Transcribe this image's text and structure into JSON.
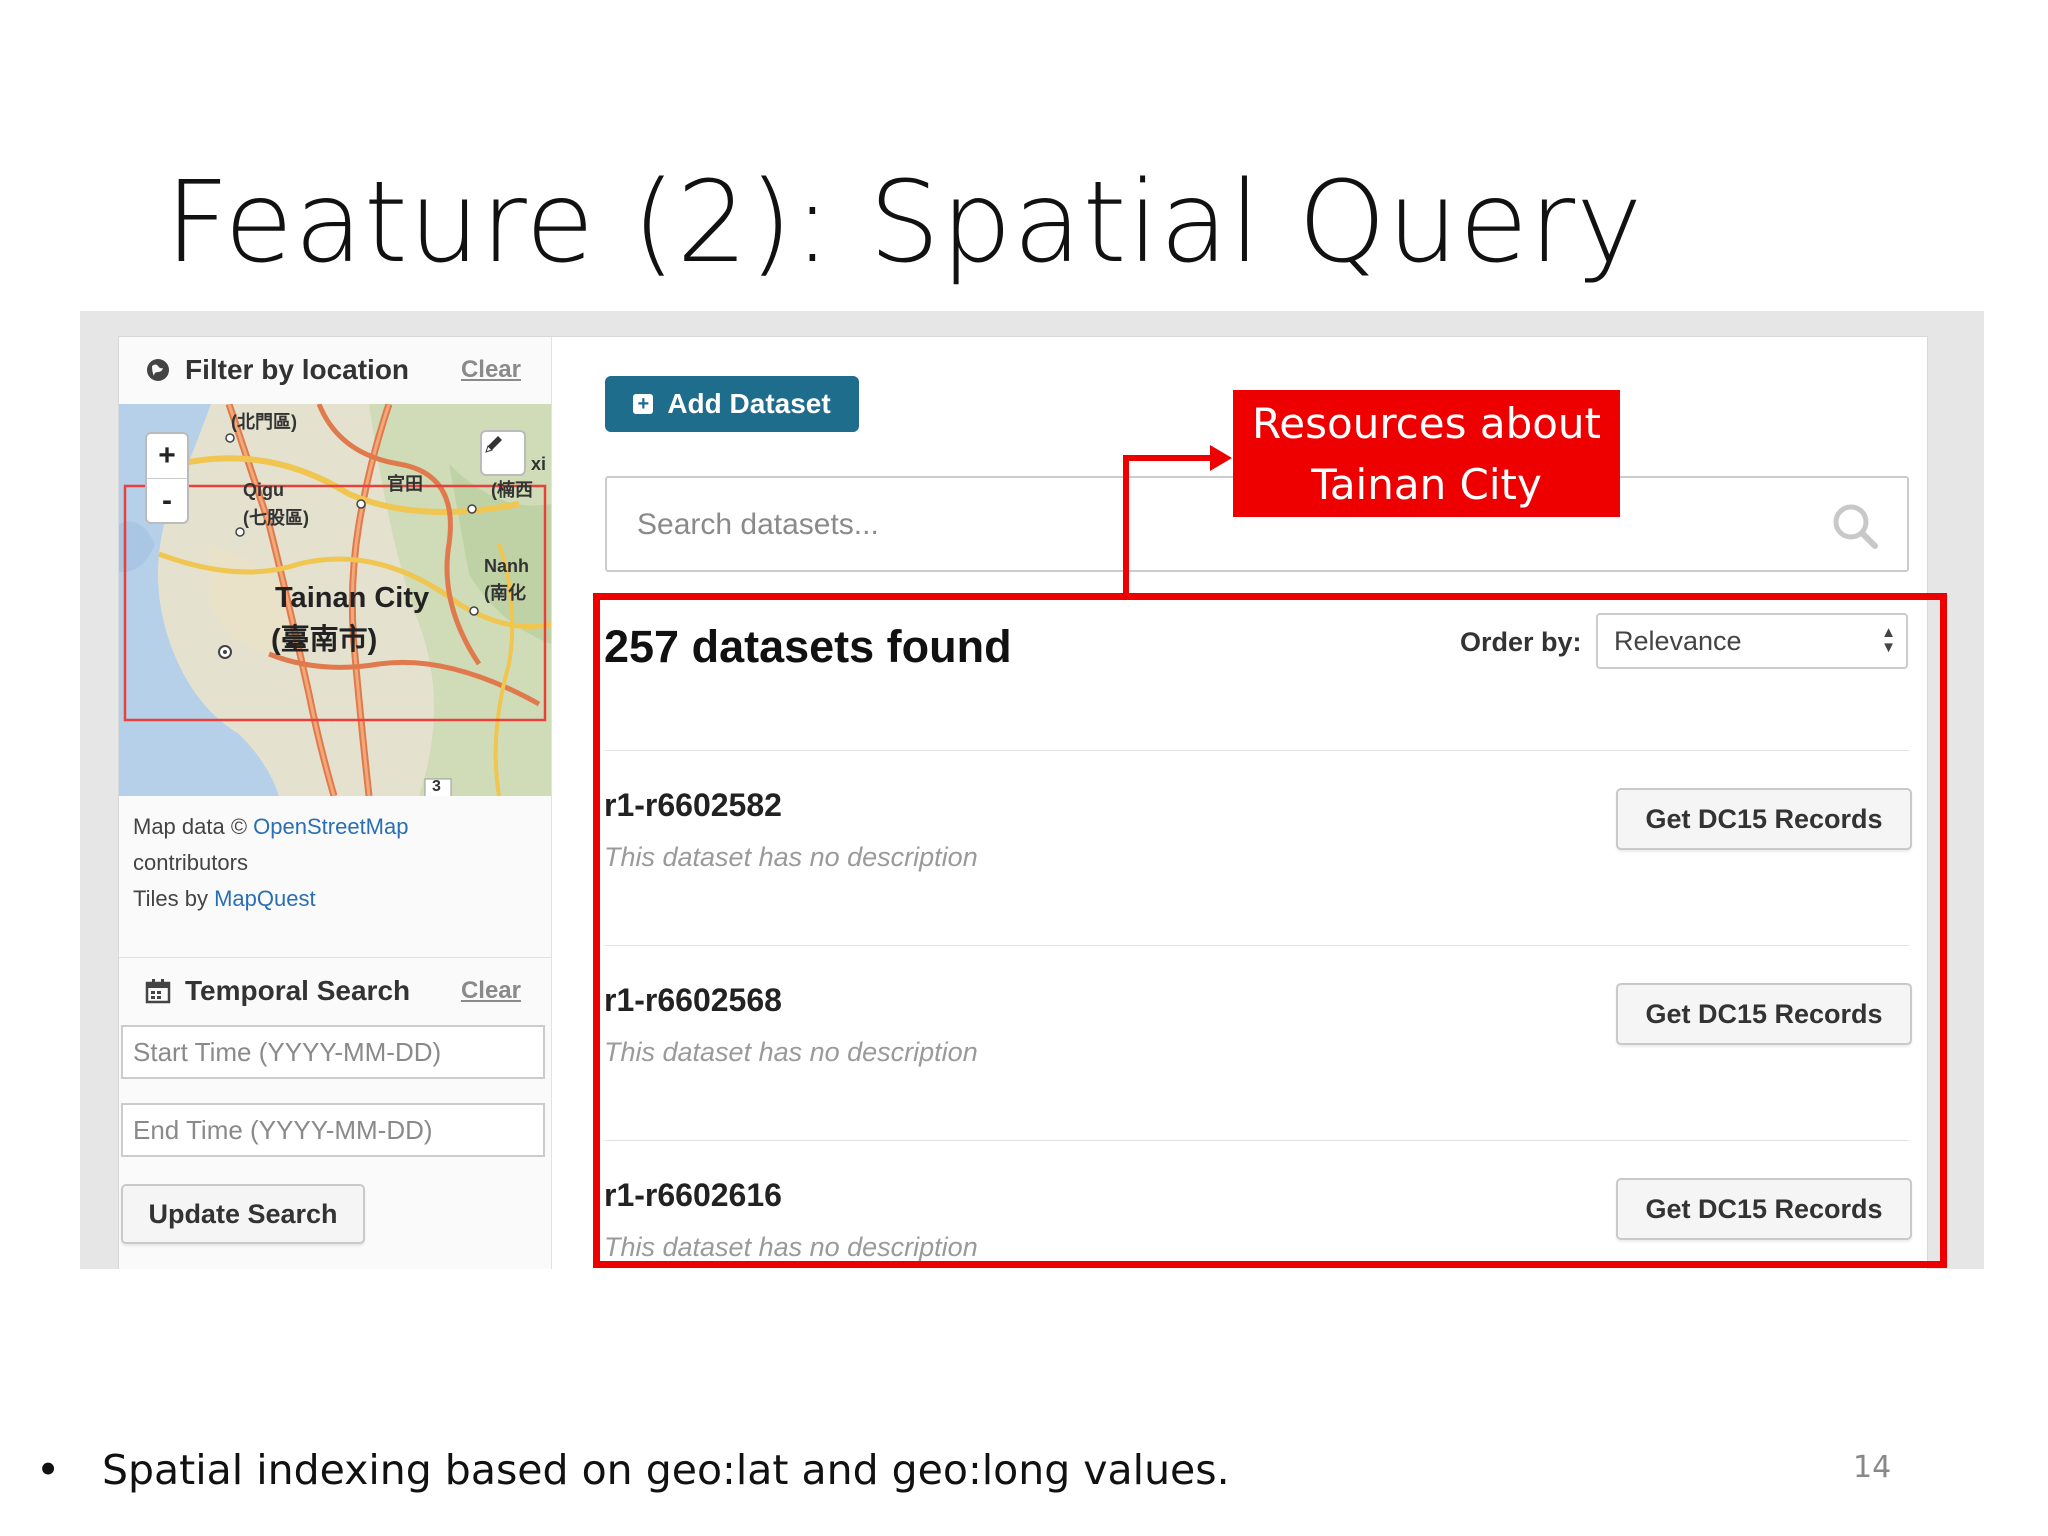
{
  "slide": {
    "title": "Feature (2): Spatial Query",
    "bullet": "Spatial indexing based on geo:lat and geo:long values.",
    "page_number": "14"
  },
  "sidebar": {
    "location_header": "Filter by location",
    "location_clear": "Clear",
    "map": {
      "zoom_in": "+",
      "zoom_out": "-",
      "labels": {
        "beimen": "(北門區)",
        "qigu": "Qigu",
        "qigu_cn": "(七股區)",
        "tainan": "Tainan City",
        "tainan_cn": "(臺南市)",
        "nanhua": "Nanh",
        "nanhua_cn": "(南化",
        "guantian": "官田",
        "xi": "xi",
        "xi_cn": "(楠西",
        "route": "3"
      }
    },
    "attribution": {
      "line1_prefix": "Map data © ",
      "osm_link": "OpenStreetMap",
      "line2": "contributors",
      "line3_prefix": "Tiles by ",
      "mapquest_link": "MapQuest"
    },
    "temporal_header": "Temporal Search",
    "temporal_clear": "Clear",
    "start_placeholder": "Start Time (YYYY-MM-DD)",
    "end_placeholder": "End Time (YYYY-MM-DD)",
    "update_button": "Update Search"
  },
  "main": {
    "add_dataset": "Add Dataset",
    "search_placeholder": "Search datasets...",
    "results_count": "257 datasets found",
    "order_label": "Order by:",
    "order_selected": "Relevance",
    "datasets": [
      {
        "title": "r1-r6602582",
        "description": "This dataset has no description",
        "button": "Get DC15 Records"
      },
      {
        "title": "r1-r6602568",
        "description": "This dataset has no description",
        "button": "Get DC15 Records"
      },
      {
        "title": "r1-r6602616",
        "description": "This dataset has no description",
        "button": "Get DC15 Records"
      }
    ]
  },
  "annotation": {
    "callout_line1": "Resources about",
    "callout_line2": "Tainan City",
    "color": "#ee0000"
  },
  "colors": {
    "primary_button": "#1f6d8d",
    "link": "#2a6fb3"
  }
}
